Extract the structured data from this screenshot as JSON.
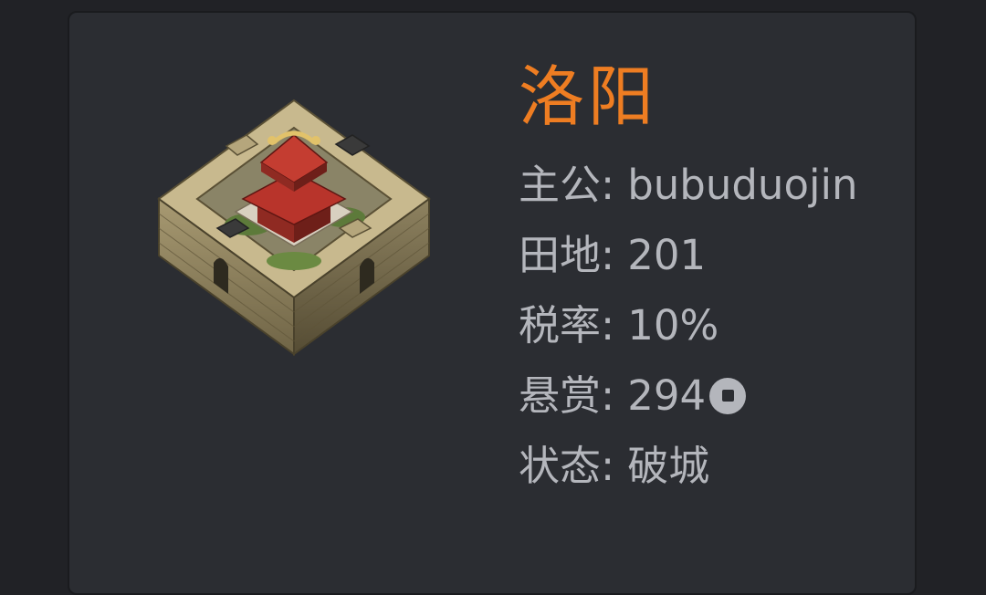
{
  "city": {
    "name": "洛阳",
    "name_color": "#ee7d22",
    "icon": "walled-city-palace-icon",
    "fields": [
      {
        "label": "主公",
        "value": "bubuduojin"
      },
      {
        "label": "田地",
        "value": "201"
      },
      {
        "label": "税率",
        "value": "10%"
      },
      {
        "label": "悬赏",
        "value": "294",
        "icon": "coin-icon"
      },
      {
        "label": "状态",
        "value": "破城"
      }
    ]
  }
}
